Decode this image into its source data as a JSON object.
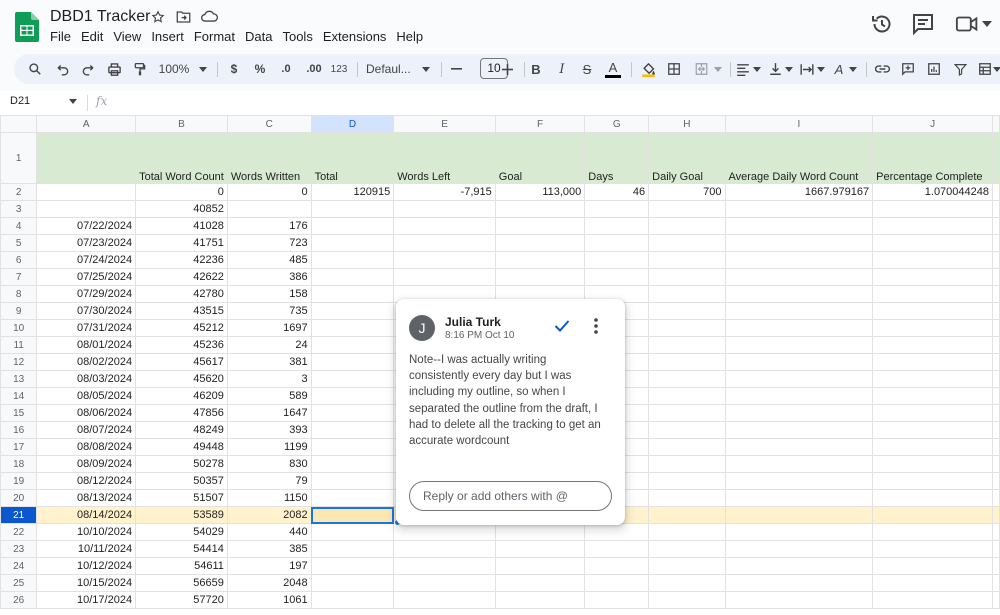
{
  "app": {
    "title": "DBD1 Tracker",
    "brand_color": "#0f9d58"
  },
  "menu": [
    "File",
    "Edit",
    "View",
    "Insert",
    "Format",
    "Data",
    "Tools",
    "Extensions",
    "Help"
  ],
  "toolbar": {
    "zoom": "100%",
    "currency": "$",
    "percent": "%",
    "decrease_decimal": ".0",
    "increase_decimal": ".00",
    "number_format": "123",
    "font": "Defaul...",
    "font_size": "10",
    "bold": "B",
    "italic": "I",
    "strike": "S",
    "text_color": "A",
    "text_rotation": "A"
  },
  "formula_bar": {
    "name_box": "D21",
    "fx": "fx",
    "content": ""
  },
  "sheet": {
    "columns": [
      "A",
      "B",
      "C",
      "D",
      "E",
      "F",
      "G",
      "H",
      "I",
      "J"
    ],
    "active_column": "D",
    "active_row": "21",
    "header_row": [
      "",
      "Total Word Count",
      "Words Written",
      "Total",
      "Words Left",
      "Goal",
      "Days",
      "Daily Goal",
      "Average Daily Word Count",
      "Percentage Complete"
    ],
    "rows": [
      {
        "n": "2",
        "cells": [
          "",
          "0",
          "0",
          "120915",
          "-7,915",
          "113,000",
          "46",
          "700",
          "1667.979167",
          "1.070044248"
        ]
      },
      {
        "n": "3",
        "cells": [
          "",
          "40852",
          "",
          "",
          "",
          "",
          "",
          "",
          "",
          ""
        ]
      },
      {
        "n": "4",
        "cells": [
          "07/22/2024",
          "41028",
          "176",
          "",
          "",
          "",
          "",
          "",
          "",
          ""
        ]
      },
      {
        "n": "5",
        "cells": [
          "07/23/2024",
          "41751",
          "723",
          "",
          "",
          "",
          "",
          "",
          "",
          ""
        ]
      },
      {
        "n": "6",
        "cells": [
          "07/24/2024",
          "42236",
          "485",
          "",
          "",
          "",
          "",
          "",
          "",
          ""
        ]
      },
      {
        "n": "7",
        "cells": [
          "07/25/2024",
          "42622",
          "386",
          "",
          "",
          "",
          "",
          "",
          "",
          ""
        ]
      },
      {
        "n": "8",
        "cells": [
          "07/29/2024",
          "42780",
          "158",
          "",
          "",
          "",
          "",
          "",
          "",
          ""
        ]
      },
      {
        "n": "9",
        "cells": [
          "07/30/2024",
          "43515",
          "735",
          "",
          "",
          "",
          "",
          "",
          "",
          ""
        ]
      },
      {
        "n": "10",
        "cells": [
          "07/31/2024",
          "45212",
          "1697",
          "",
          "",
          "",
          "",
          "",
          "",
          ""
        ]
      },
      {
        "n": "11",
        "cells": [
          "08/01/2024",
          "45236",
          "24",
          "",
          "",
          "",
          "",
          "",
          "",
          ""
        ]
      },
      {
        "n": "12",
        "cells": [
          "08/02/2024",
          "45617",
          "381",
          "",
          "",
          "",
          "",
          "",
          "",
          ""
        ]
      },
      {
        "n": "13",
        "cells": [
          "08/03/2024",
          "45620",
          "3",
          "",
          "",
          "",
          "",
          "",
          "",
          ""
        ]
      },
      {
        "n": "14",
        "cells": [
          "08/05/2024",
          "46209",
          "589",
          "",
          "",
          "",
          "",
          "",
          "",
          ""
        ]
      },
      {
        "n": "15",
        "cells": [
          "08/06/2024",
          "47856",
          "1647",
          "",
          "",
          "",
          "",
          "",
          "",
          ""
        ]
      },
      {
        "n": "16",
        "cells": [
          "08/07/2024",
          "48249",
          "393",
          "",
          "",
          "",
          "",
          "",
          "",
          ""
        ]
      },
      {
        "n": "17",
        "cells": [
          "08/08/2024",
          "49448",
          "1199",
          "",
          "",
          "",
          "",
          "",
          "",
          ""
        ]
      },
      {
        "n": "18",
        "cells": [
          "08/09/2024",
          "50278",
          "830",
          "",
          "",
          "",
          "",
          "",
          "",
          ""
        ]
      },
      {
        "n": "19",
        "cells": [
          "08/12/2024",
          "50357",
          "79",
          "",
          "",
          "",
          "",
          "",
          "",
          ""
        ]
      },
      {
        "n": "20",
        "cells": [
          "08/13/2024",
          "51507",
          "1150",
          "",
          "",
          "",
          "",
          "",
          "",
          ""
        ]
      },
      {
        "n": "21",
        "cells": [
          "08/14/2024",
          "53589",
          "2082",
          "",
          "",
          "",
          "",
          "",
          "",
          ""
        ]
      },
      {
        "n": "22",
        "cells": [
          "10/10/2024",
          "54029",
          "440",
          "",
          "",
          "",
          "",
          "",
          "",
          ""
        ]
      },
      {
        "n": "23",
        "cells": [
          "10/11/2024",
          "54414",
          "385",
          "",
          "",
          "",
          "",
          "",
          "",
          ""
        ]
      },
      {
        "n": "24",
        "cells": [
          "10/12/2024",
          "54611",
          "197",
          "",
          "",
          "",
          "",
          "",
          "",
          ""
        ]
      },
      {
        "n": "25",
        "cells": [
          "10/15/2024",
          "56659",
          "2048",
          "",
          "",
          "",
          "",
          "",
          "",
          ""
        ]
      },
      {
        "n": "26",
        "cells": [
          "10/17/2024",
          "57720",
          "1061",
          "",
          "",
          "",
          "",
          "",
          "",
          ""
        ]
      }
    ]
  },
  "comment": {
    "initial": "J",
    "author": "Julia Turk",
    "time": "8:16 PM Oct 10",
    "body": "Note--I was actually writing consistently every day but I was including my outline, so when I separated the outline from the draft, I had to delete all the tracking to get an accurate wordcount",
    "reply_placeholder": "Reply or add others with @"
  }
}
